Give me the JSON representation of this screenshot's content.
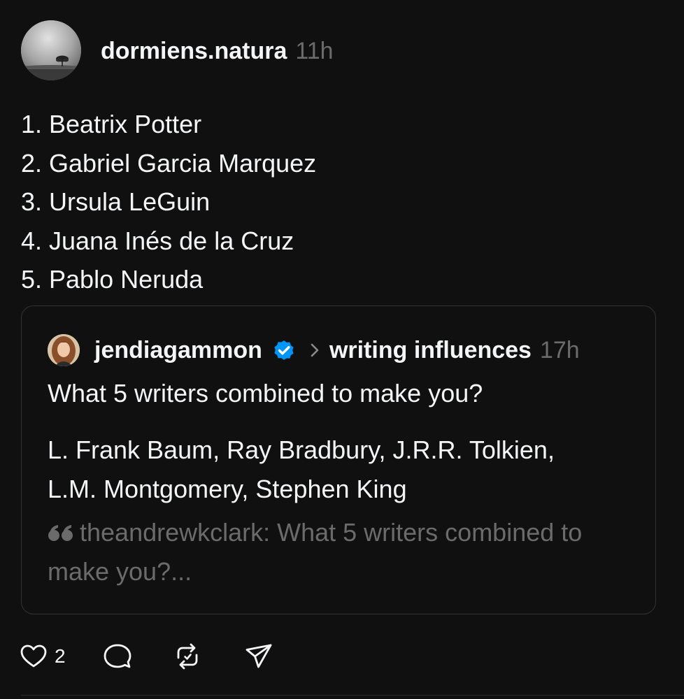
{
  "post": {
    "username": "dormiens.natura",
    "time": "11h",
    "list": [
      "1. Beatrix Potter",
      "2. Gabriel Garcia Marquez",
      "3. Ursula LeGuin",
      "4. Juana Inés de la Cruz",
      "5. Pablo Neruda"
    ]
  },
  "quote": {
    "username": "jendiagammon",
    "verified": true,
    "topic": "writing influences",
    "time": "17h",
    "question": "What 5 writers combined to make you?",
    "answer_lines": [
      "L. Frank Baum, Ray Bradbury, J.R.R. Tolkien,",
      "L.M. Montgomery, Stephen King"
    ],
    "nested_quote": "theandrewkclark: What 5 writers combined to make you?..."
  },
  "actions": {
    "like_count": "2",
    "icons": [
      "heart-icon",
      "comment-icon",
      "repost-icon",
      "share-icon"
    ]
  },
  "colors": {
    "background": "#101010",
    "primary_text": "#f3f5f7",
    "secondary_text": "#6b6b6b",
    "border": "#333333",
    "verified_badge": "#0095f6"
  }
}
